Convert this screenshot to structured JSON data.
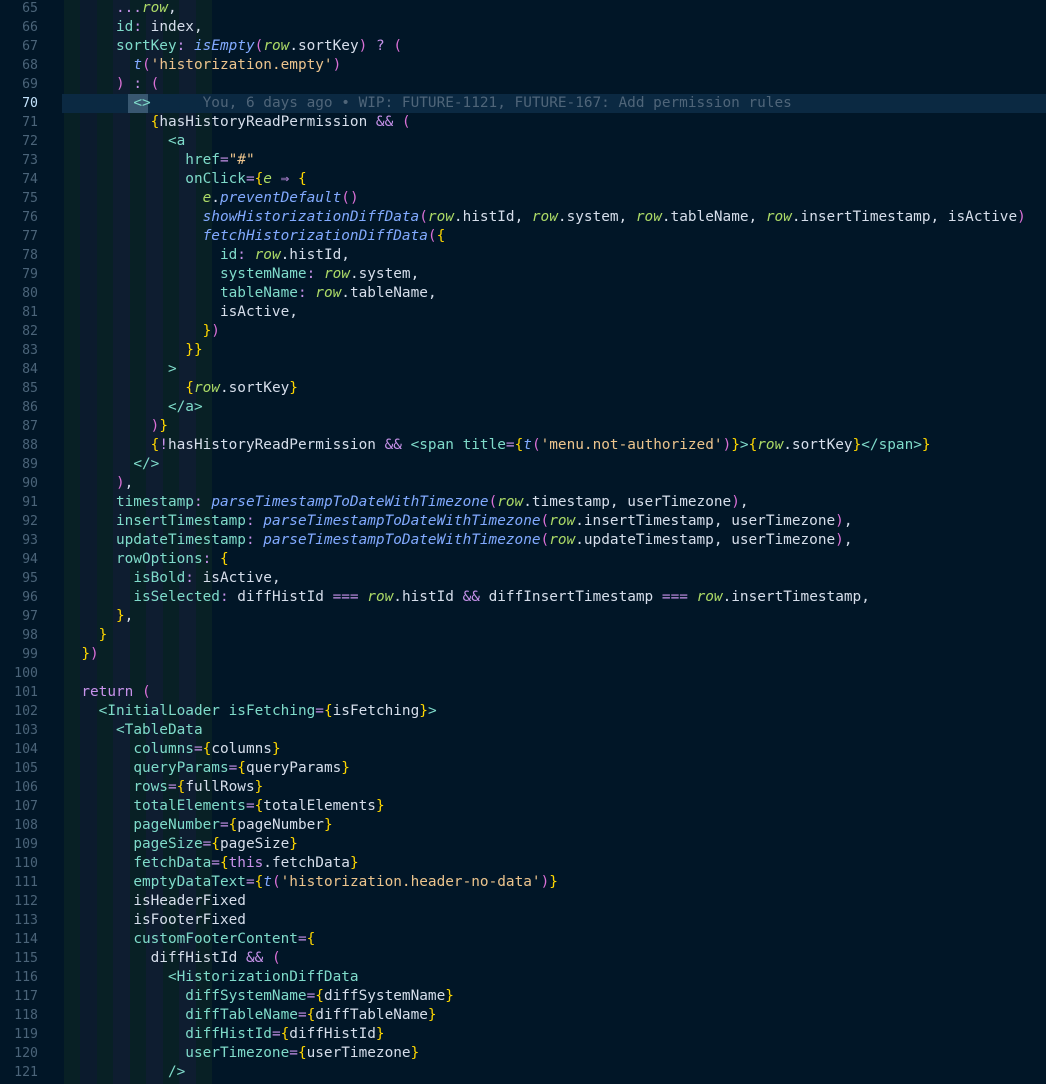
{
  "editor": {
    "active_line": 70,
    "blame": "You, 6 days ago • WIP: FUTURE-1121, FUTURE-167: Add permission rules",
    "lines": [
      {
        "n": 65,
        "indent": "      ",
        "t": "...row,"
      },
      {
        "n": 66,
        "indent": "      ",
        "t": "id: index,"
      },
      {
        "n": 67,
        "indent": "      ",
        "t": "sortKey: isEmpty(row.sortKey) ? ("
      },
      {
        "n": 68,
        "indent": "        ",
        "t": "t('historization.empty')"
      },
      {
        "n": 69,
        "indent": "      ",
        "t": ") : ("
      },
      {
        "n": 70,
        "indent": "        ",
        "t": "<>"
      },
      {
        "n": 71,
        "indent": "          ",
        "t": "{hasHistoryReadPermission && ("
      },
      {
        "n": 72,
        "indent": "            ",
        "t": "<a"
      },
      {
        "n": 73,
        "indent": "              ",
        "t": "href=\"#\""
      },
      {
        "n": 74,
        "indent": "              ",
        "t": "onClick={e ⇒ {"
      },
      {
        "n": 75,
        "indent": "                ",
        "t": "e.preventDefault()"
      },
      {
        "n": 76,
        "indent": "                ",
        "t": "showHistorizationDiffData(row.histId, row.system, row.tableName, row.insertTimestamp, isActive)"
      },
      {
        "n": 77,
        "indent": "                ",
        "t": "fetchHistorizationDiffData({"
      },
      {
        "n": 78,
        "indent": "                  ",
        "t": "id: row.histId,"
      },
      {
        "n": 79,
        "indent": "                  ",
        "t": "systemName: row.system,"
      },
      {
        "n": 80,
        "indent": "                  ",
        "t": "tableName: row.tableName,"
      },
      {
        "n": 81,
        "indent": "                  ",
        "t": "isActive,"
      },
      {
        "n": 82,
        "indent": "                ",
        "t": "})"
      },
      {
        "n": 83,
        "indent": "              ",
        "t": "}}"
      },
      {
        "n": 84,
        "indent": "            ",
        "t": ">"
      },
      {
        "n": 85,
        "indent": "              ",
        "t": "{row.sortKey}"
      },
      {
        "n": 86,
        "indent": "            ",
        "t": "</a>"
      },
      {
        "n": 87,
        "indent": "          ",
        "t": ")}"
      },
      {
        "n": 88,
        "indent": "          ",
        "t": "{!hasHistoryReadPermission && <span title={t('menu.not-authorized')}>{row.sortKey}</span>}"
      },
      {
        "n": 89,
        "indent": "        ",
        "t": "</>"
      },
      {
        "n": 90,
        "indent": "      ",
        "t": "),"
      },
      {
        "n": 91,
        "indent": "      ",
        "t": "timestamp: parseTimestampToDateWithTimezone(row.timestamp, userTimezone),"
      },
      {
        "n": 92,
        "indent": "      ",
        "t": "insertTimestamp: parseTimestampToDateWithTimezone(row.insertTimestamp, userTimezone),"
      },
      {
        "n": 93,
        "indent": "      ",
        "t": "updateTimestamp: parseTimestampToDateWithTimezone(row.updateTimestamp, userTimezone),"
      },
      {
        "n": 94,
        "indent": "      ",
        "t": "rowOptions: {"
      },
      {
        "n": 95,
        "indent": "        ",
        "t": "isBold: isActive,"
      },
      {
        "n": 96,
        "indent": "        ",
        "t": "isSelected: diffHistId === row.histId && diffInsertTimestamp === row.insertTimestamp,"
      },
      {
        "n": 97,
        "indent": "      ",
        "t": "},"
      },
      {
        "n": 98,
        "indent": "    ",
        "t": "}"
      },
      {
        "n": 99,
        "indent": "  ",
        "t": "})"
      },
      {
        "n": 100,
        "indent": "",
        "t": ""
      },
      {
        "n": 101,
        "indent": "  ",
        "t": "return ("
      },
      {
        "n": 102,
        "indent": "    ",
        "t": "<InitialLoader isFetching={isFetching}>"
      },
      {
        "n": 103,
        "indent": "      ",
        "t": "<TableData"
      },
      {
        "n": 104,
        "indent": "        ",
        "t": "columns={columns}"
      },
      {
        "n": 105,
        "indent": "        ",
        "t": "queryParams={queryParams}"
      },
      {
        "n": 106,
        "indent": "        ",
        "t": "rows={fullRows}"
      },
      {
        "n": 107,
        "indent": "        ",
        "t": "totalElements={totalElements}"
      },
      {
        "n": 108,
        "indent": "        ",
        "t": "pageNumber={pageNumber}"
      },
      {
        "n": 109,
        "indent": "        ",
        "t": "pageSize={pageSize}"
      },
      {
        "n": 110,
        "indent": "        ",
        "t": "fetchData={this.fetchData}"
      },
      {
        "n": 111,
        "indent": "        ",
        "t": "emptyDataText={t('historization.header-no-data')}"
      },
      {
        "n": 112,
        "indent": "        ",
        "t": "isHeaderFixed"
      },
      {
        "n": 113,
        "indent": "        ",
        "t": "isFooterFixed"
      },
      {
        "n": 114,
        "indent": "        ",
        "t": "customFooterContent={"
      },
      {
        "n": 115,
        "indent": "          ",
        "t": "diffHistId && ("
      },
      {
        "n": 116,
        "indent": "            ",
        "t": "<HistorizationDiffData"
      },
      {
        "n": 117,
        "indent": "              ",
        "t": "diffSystemName={diffSystemName}"
      },
      {
        "n": 118,
        "indent": "              ",
        "t": "diffTableName={diffTableName}"
      },
      {
        "n": 119,
        "indent": "              ",
        "t": "diffHistId={diffHistId}"
      },
      {
        "n": 120,
        "indent": "              ",
        "t": "userTimezone={userTimezone}"
      },
      {
        "n": 121,
        "indent": "            ",
        "t": "/>"
      }
    ]
  },
  "colors": {
    "background": "#011627",
    "line_number": "#4b6479",
    "active_line_number": "#c5e4fd",
    "current_line": "#0b2942",
    "keyword": "#c792ea",
    "function": "#82aaff",
    "property": "#7fdbca",
    "string": "#ecc48d",
    "bracket_gold": "#ffd700",
    "blame_text": "#4f6579"
  }
}
